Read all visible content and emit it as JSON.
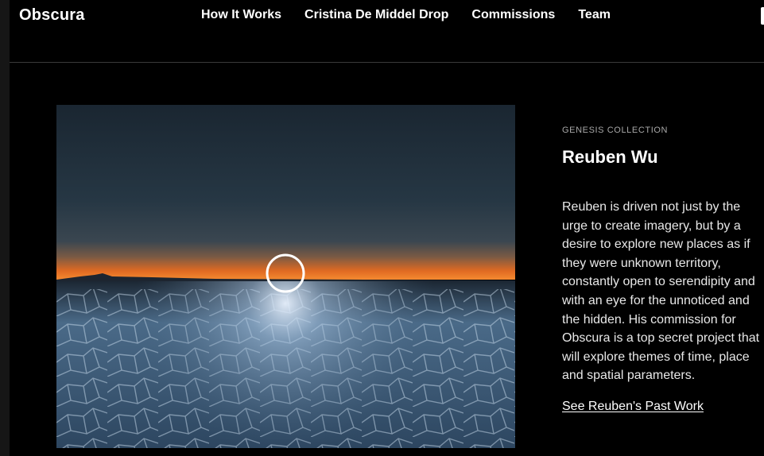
{
  "header": {
    "logo": "Obscura",
    "nav": [
      {
        "label": "How It Works"
      },
      {
        "label": "Cristina De Middel Drop"
      },
      {
        "label": "Commissions"
      },
      {
        "label": "Team"
      }
    ]
  },
  "feature": {
    "collection": "GENESIS COLLECTION",
    "artist": "Reuben Wu",
    "bio": "Reuben is driven not just by the urge to create imagery, but by a desire to explore new places as if they were unknown territory, constantly open to serendipity and with an eye for the unnoticed and the hidden. His commission for Obscura is a top secret project that will explore themes of time, place and spatial parameters.",
    "link_label": "See Reuben's Past Work"
  },
  "artwork": {
    "subject": "salt-flat-light-ring-photo",
    "colors": {
      "sky_top": "#1c2a35",
      "sky_mid": "#2b3a46",
      "horizon_glow": "#f07a2a",
      "ground": "#3f5c78",
      "ring": "#ffffff"
    }
  }
}
